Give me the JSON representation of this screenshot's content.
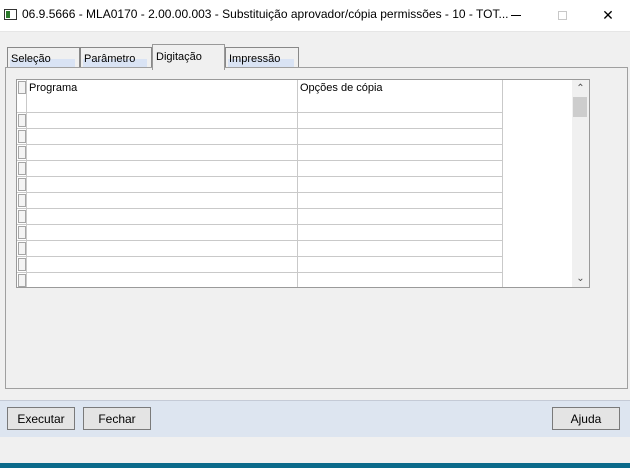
{
  "window": {
    "title": "06.9.5666 - MLA0170 - 2.00.00.003 - Substituição aprovador/cópia permissões - 10 - TOT...",
    "minimize": "—",
    "maximize": "□",
    "close": "✕"
  },
  "tabs": [
    {
      "label": "Seleção"
    },
    {
      "label": "Parâmetro"
    },
    {
      "label": "Digitação",
      "active": true
    },
    {
      "label": "Impressão"
    }
  ],
  "grid": {
    "columns": [
      "Programa",
      "Opções de cópia"
    ],
    "rows": [
      [
        "",
        ""
      ],
      [
        "",
        ""
      ],
      [
        "",
        ""
      ],
      [
        "",
        ""
      ],
      [
        "",
        ""
      ],
      [
        "",
        ""
      ],
      [
        "",
        ""
      ],
      [
        "",
        ""
      ],
      [
        "",
        ""
      ],
      [
        "",
        ""
      ],
      [
        "",
        ""
      ]
    ],
    "scroll_up": "⌃",
    "scroll_down": "⌄"
  },
  "buttons": {
    "execute": "Executar",
    "close": "Fechar",
    "help": "Ajuda"
  },
  "colors": {
    "bottom_bar": "#dde5f0",
    "tab_underline": "#d9e3f4"
  }
}
